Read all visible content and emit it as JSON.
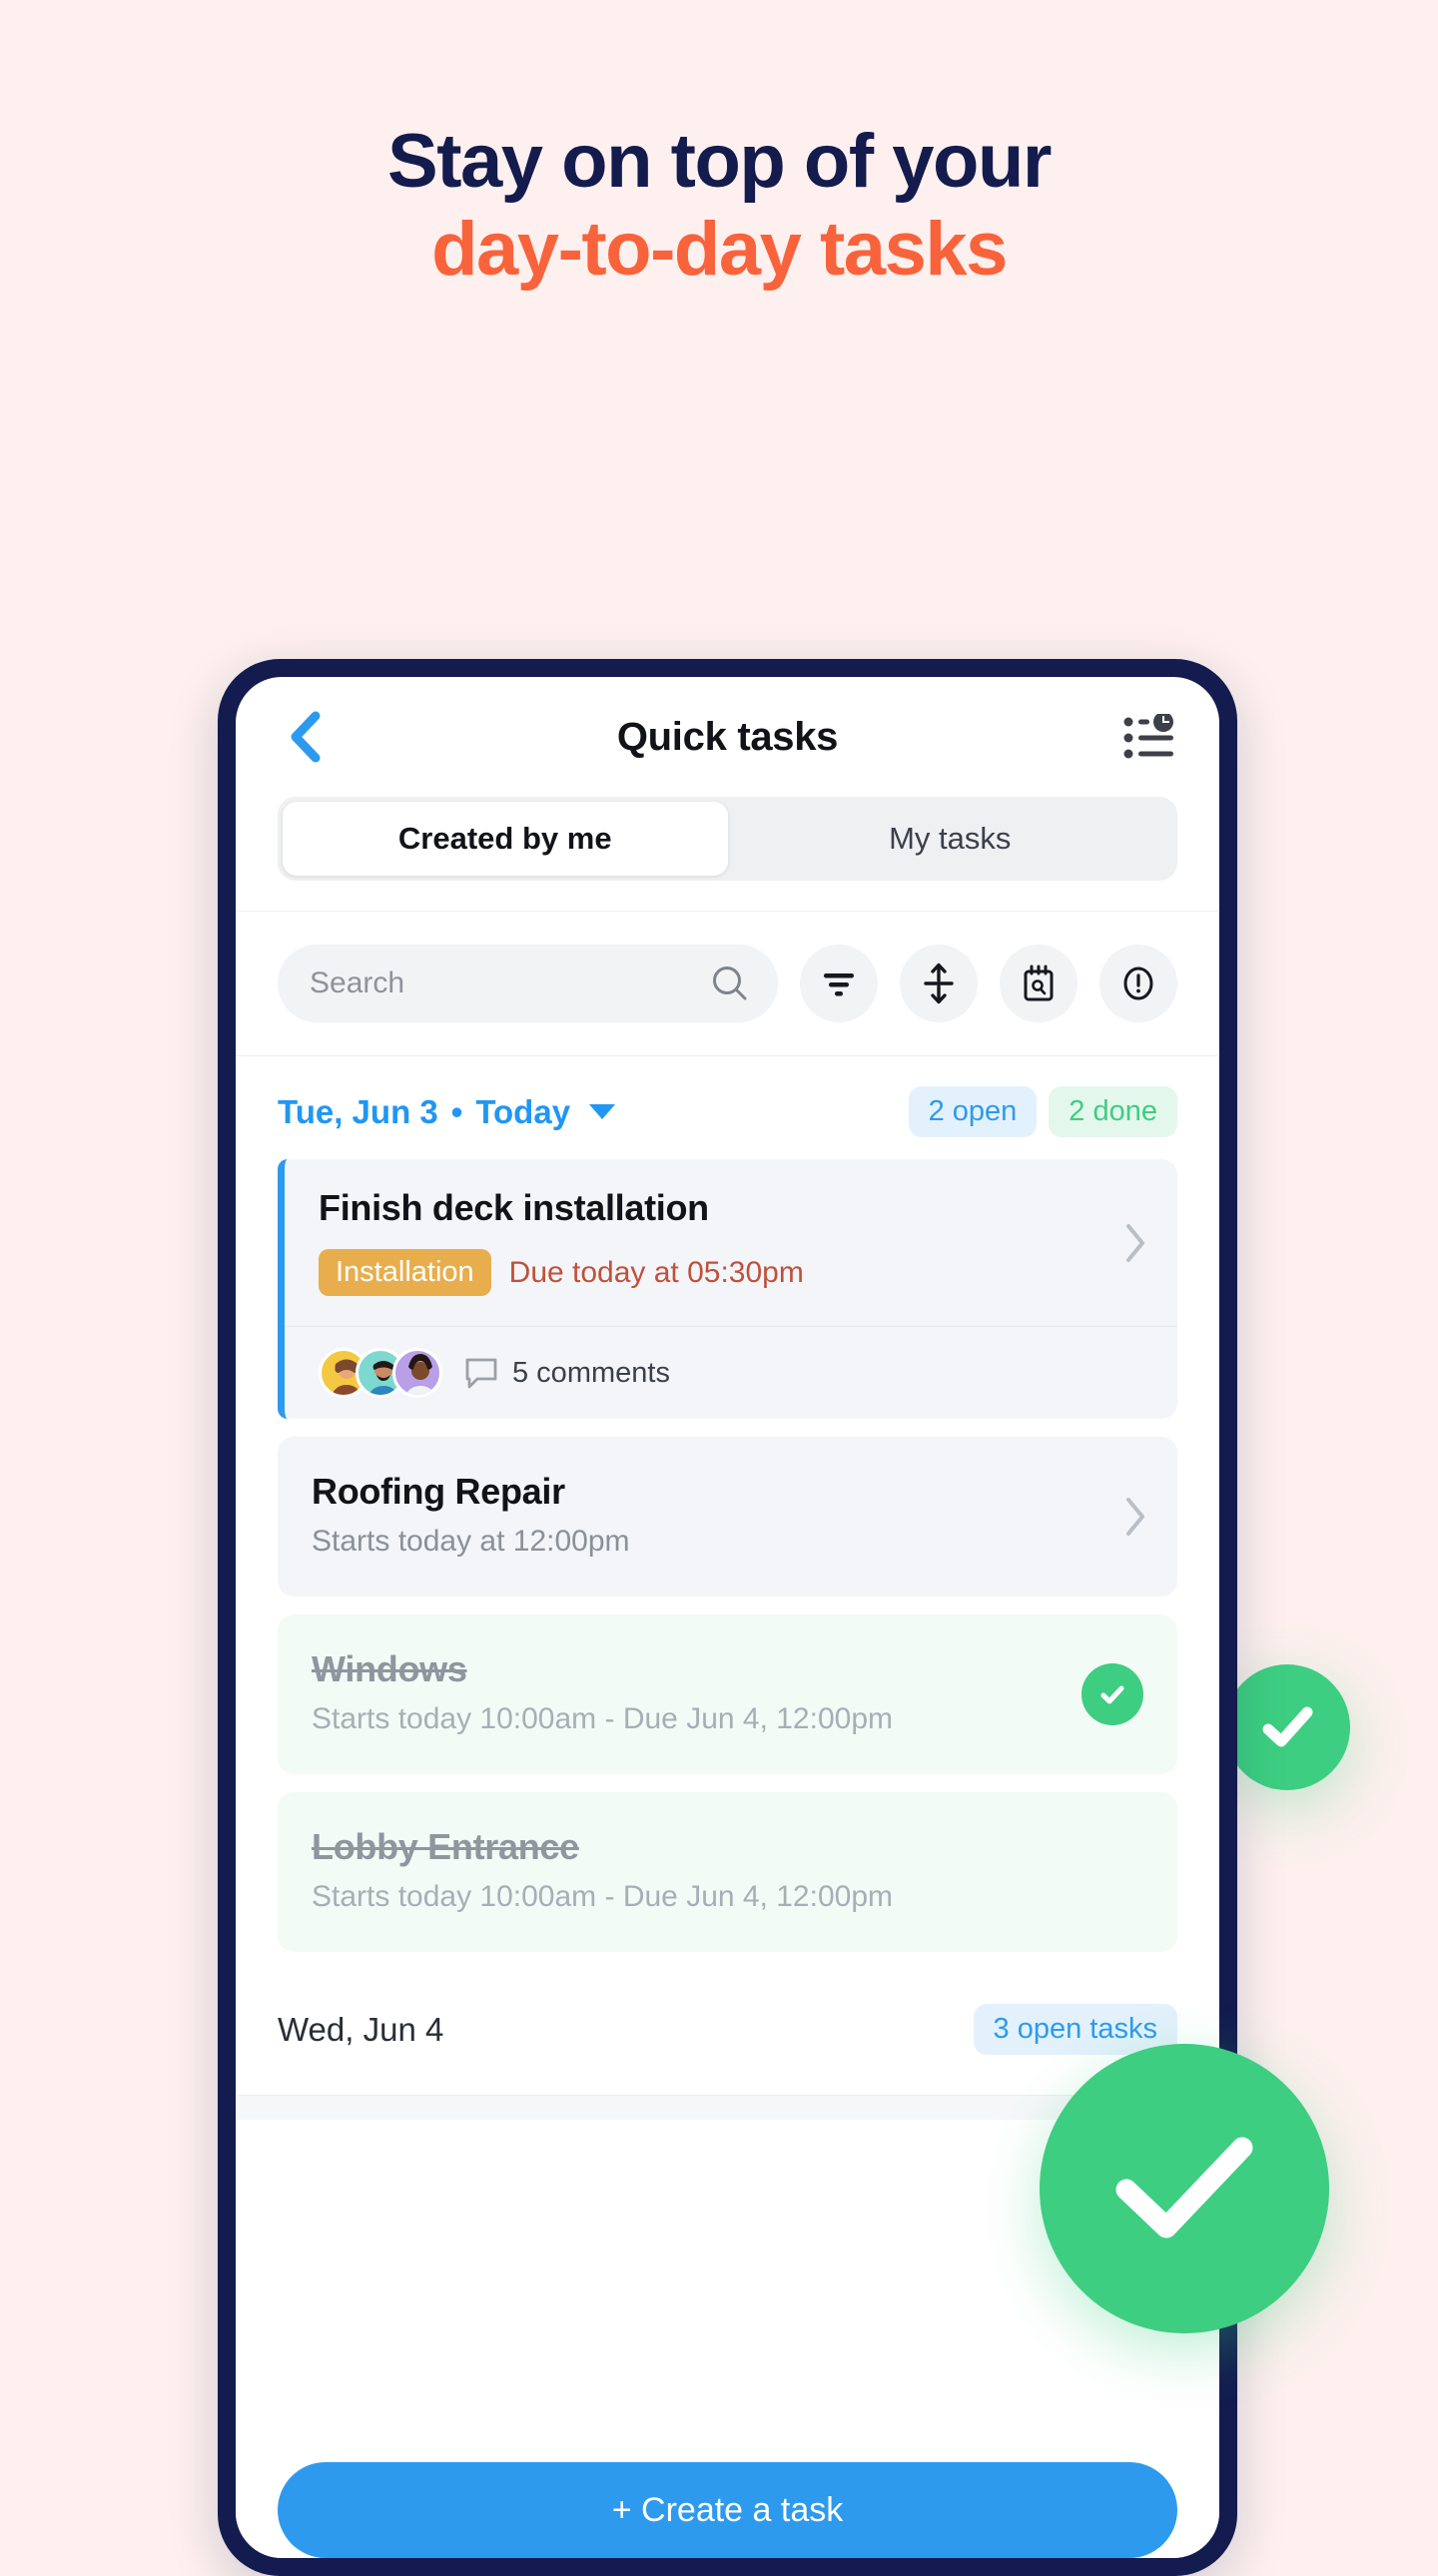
{
  "promo": {
    "headline_line1": "Stay on top of your",
    "headline_line2": "day-to-day tasks",
    "navy": "#141B4D",
    "orange": "#F9633B",
    "background": "#FDF0EE",
    "green": "#3DCE81"
  },
  "app": {
    "title": "Quick tasks",
    "back_icon": "chevron-left-icon",
    "activity_icon": "activity-list-icon"
  },
  "tabs": [
    {
      "label": "Created by me",
      "active": true
    },
    {
      "label": "My tasks",
      "active": false
    }
  ],
  "toolbar": {
    "search_placeholder": "Search",
    "search_value": "",
    "buttons": [
      {
        "name": "filter-icon"
      },
      {
        "name": "sort-icon"
      },
      {
        "name": "calendar-search-icon"
      },
      {
        "name": "alert-icon"
      }
    ]
  },
  "group": {
    "date": "Tue, Jun 3",
    "separator": "•",
    "today_label": "Today",
    "badge_open": "2 open",
    "badge_done": "2 done"
  },
  "tasks": [
    {
      "title": "Finish deck installation",
      "tag": "Installation",
      "tag_color": "#E8AE4D",
      "due": "Due today at 05:30pm",
      "due_color": "#C0513C",
      "comments": "5 comments",
      "avatar_colors": [
        "#F5C842",
        "#7DD8D0",
        "#B89FE8"
      ],
      "done": false,
      "accent": true
    },
    {
      "title": "Roofing Repair",
      "subtitle": "Starts today at 12:00pm",
      "done": false,
      "accent": false
    },
    {
      "title": "Windows",
      "subtitle": "Starts today 10:00am - Due Jun 4, 12:00pm",
      "done": true
    },
    {
      "title": "Lobby Entrance",
      "subtitle": "Starts today 10:00am - Due Jun 4, 12:00pm",
      "done": true
    }
  ],
  "next_group": {
    "date": "Wed, Jun 4",
    "badge": "3 open tasks"
  },
  "cta": {
    "label": "+ Create a task"
  }
}
